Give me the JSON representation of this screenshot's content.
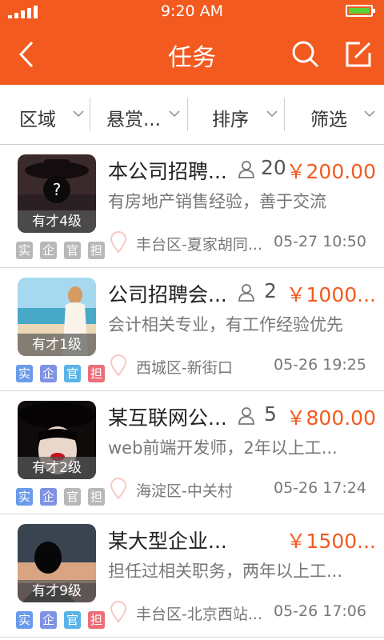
{
  "status_bar": {
    "time": "9:20 AM"
  },
  "header": {
    "title": "任务"
  },
  "filters": [
    {
      "label": "区域"
    },
    {
      "label": "悬赏..."
    },
    {
      "label": "排序"
    },
    {
      "label": "筛选"
    }
  ],
  "badge_labels": {
    "real": "实",
    "corp": "企",
    "official": "官",
    "guarantee": "担"
  },
  "colors": {
    "brand": "#f35a20",
    "badge_real": "#6a9bea",
    "badge_corp": "#7f92e3",
    "badge_official": "#59b3e6",
    "badge_guarantee": "#ea6f78",
    "badge_inactive": "#b8b8b8"
  },
  "tasks": [
    {
      "title": "本公司招聘...",
      "count": "20",
      "price": "￥200.00",
      "desc": "有房地产销售经验，善于交流",
      "level": "有才4级",
      "location": "丰台区-夏家胡同...",
      "time": "05-27 10:50"
    },
    {
      "title": "公司招聘会...",
      "count": "2",
      "price": "￥1000...",
      "desc": "会计相关专业，有工作经验优先",
      "level": "有才1级",
      "location": "西城区-新街口",
      "time": "05-26 19:25"
    },
    {
      "title": "某互联网公...",
      "count": "5",
      "price": "￥800.00",
      "desc": "web前端开发师，2年以上工...",
      "level": "有才2级",
      "location": "海淀区-中关村",
      "time": "05-26 17:24"
    },
    {
      "title": "某大型企业...",
      "count": "",
      "price": "￥1500...",
      "desc": "担任过相关职务，两年以上工...",
      "level": "有才9级",
      "location": "丰台区-北京西站...",
      "time": "05-26 17:06"
    }
  ]
}
